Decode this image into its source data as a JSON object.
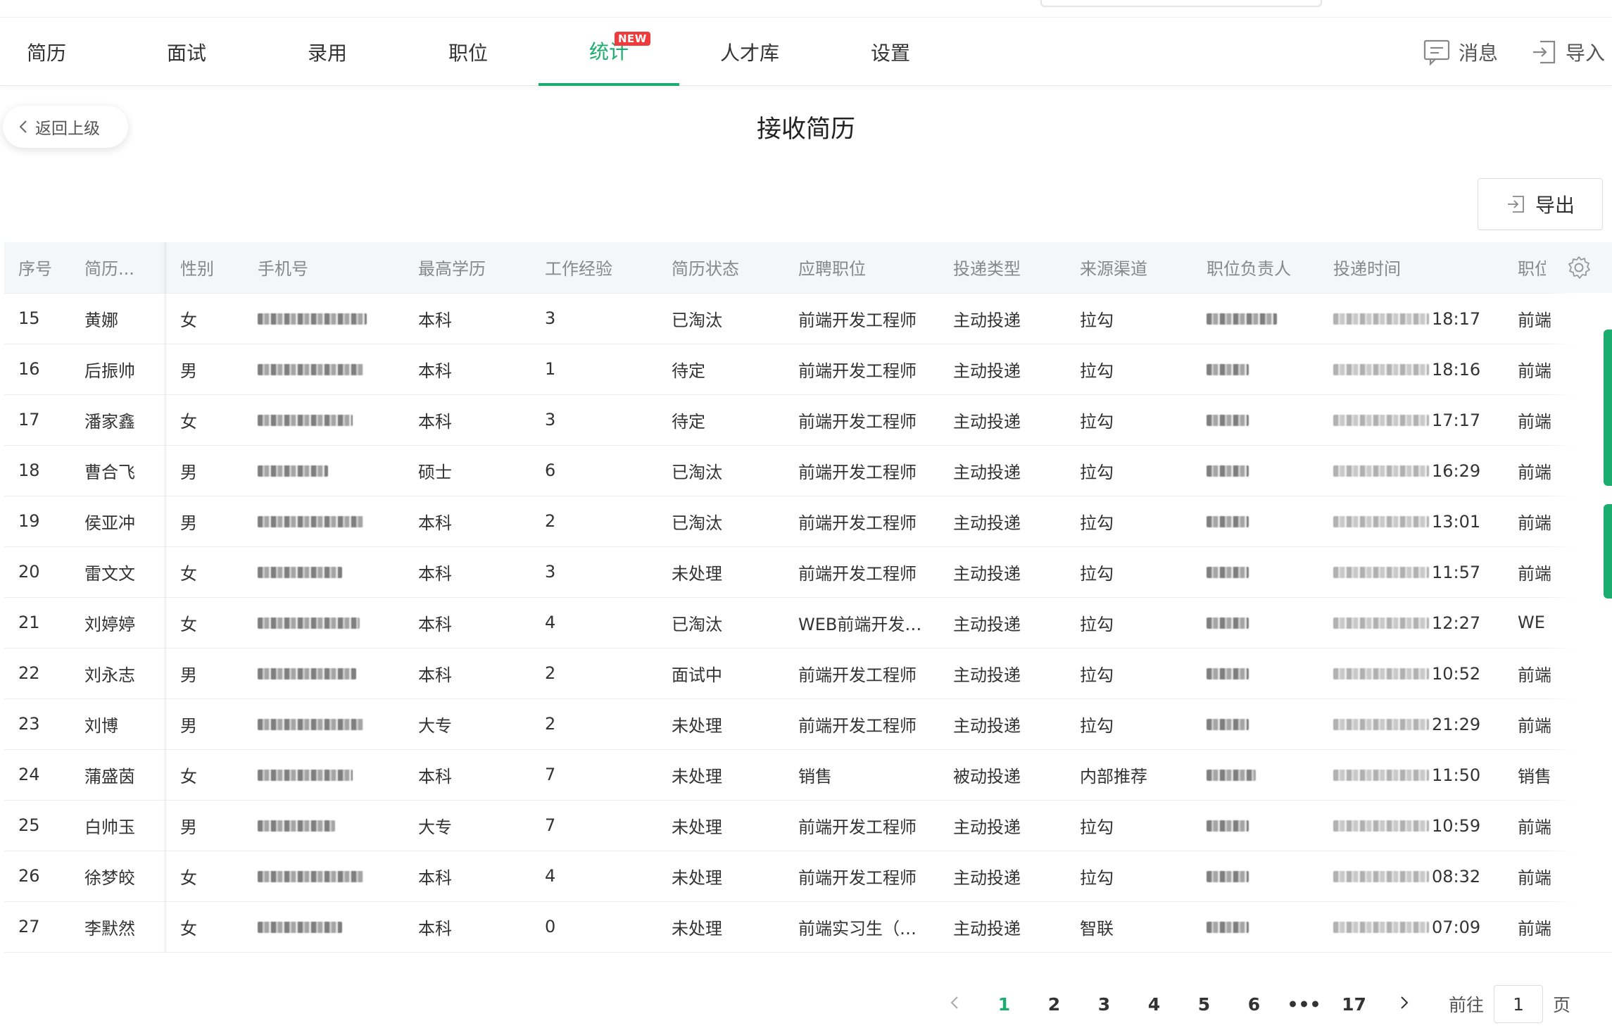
{
  "nav": {
    "tabs": [
      {
        "label": "简历"
      },
      {
        "label": "面试"
      },
      {
        "label": "录用"
      },
      {
        "label": "职位"
      },
      {
        "label": "统计",
        "badge": "NEW"
      },
      {
        "label": "人才库"
      },
      {
        "label": "设置"
      }
    ],
    "messages_label": "消息",
    "import_label": "导入"
  },
  "back_label": "返回上级",
  "page_title": "接收简历",
  "export_label": "导出",
  "table": {
    "columns": [
      "序号",
      "简历...",
      "性别",
      "手机号",
      "最高学历",
      "工作经验",
      "简历状态",
      "应聘职位",
      "投递类型",
      "来源渠道",
      "职位负责人",
      "投递时间",
      "职位"
    ],
    "rows": [
      {
        "no": "15",
        "name": "黄娜",
        "gender": "女",
        "edu": "本科",
        "exp": "3",
        "status": "已淘汰",
        "position": "前端开发工程师",
        "type": "主动投递",
        "source": "拉勾",
        "time": "18:17",
        "pos2": "前端"
      },
      {
        "no": "16",
        "name": "后振帅",
        "gender": "男",
        "edu": "本科",
        "exp": "1",
        "status": "待定",
        "position": "前端开发工程师",
        "type": "主动投递",
        "source": "拉勾",
        "time": "18:16",
        "pos2": "前端"
      },
      {
        "no": "17",
        "name": "潘家鑫",
        "gender": "女",
        "edu": "本科",
        "exp": "3",
        "status": "待定",
        "position": "前端开发工程师",
        "type": "主动投递",
        "source": "拉勾",
        "time": "17:17",
        "pos2": "前端"
      },
      {
        "no": "18",
        "name": "曹合飞",
        "gender": "男",
        "edu": "硕士",
        "exp": "6",
        "status": "已淘汰",
        "position": "前端开发工程师",
        "type": "主动投递",
        "source": "拉勾",
        "time": "16:29",
        "pos2": "前端"
      },
      {
        "no": "19",
        "name": "侯亚冲",
        "gender": "男",
        "edu": "本科",
        "exp": "2",
        "status": "已淘汰",
        "position": "前端开发工程师",
        "type": "主动投递",
        "source": "拉勾",
        "time": "13:01",
        "pos2": "前端"
      },
      {
        "no": "20",
        "name": "雷文文",
        "gender": "女",
        "edu": "本科",
        "exp": "3",
        "status": "未处理",
        "position": "前端开发工程师",
        "type": "主动投递",
        "source": "拉勾",
        "time": "11:57",
        "pos2": "前端"
      },
      {
        "no": "21",
        "name": "刘婷婷",
        "gender": "女",
        "edu": "本科",
        "exp": "4",
        "status": "已淘汰",
        "position": "WEB前端开发…",
        "type": "主动投递",
        "source": "拉勾",
        "time": "12:27",
        "pos2": "WE"
      },
      {
        "no": "22",
        "name": "刘永志",
        "gender": "男",
        "edu": "本科",
        "exp": "2",
        "status": "面试中",
        "position": "前端开发工程师",
        "type": "主动投递",
        "source": "拉勾",
        "time": "10:52",
        "pos2": "前端"
      },
      {
        "no": "23",
        "name": "刘博",
        "gender": "男",
        "edu": "大专",
        "exp": "2",
        "status": "未处理",
        "position": "前端开发工程师",
        "type": "主动投递",
        "source": "拉勾",
        "time": "21:29",
        "pos2": "前端"
      },
      {
        "no": "24",
        "name": "蒲盛茵",
        "gender": "女",
        "edu": "本科",
        "exp": "7",
        "status": "未处理",
        "position": "销售",
        "type": "被动投递",
        "source": "内部推荐",
        "time": "11:50",
        "pos2": "销售"
      },
      {
        "no": "25",
        "name": "白帅玉",
        "gender": "男",
        "edu": "大专",
        "exp": "7",
        "status": "未处理",
        "position": "前端开发工程师",
        "type": "主动投递",
        "source": "拉勾",
        "time": "10:59",
        "pos2": "前端"
      },
      {
        "no": "26",
        "name": "徐梦皎",
        "gender": "女",
        "edu": "本科",
        "exp": "4",
        "status": "未处理",
        "position": "前端开发工程师",
        "type": "主动投递",
        "source": "拉勾",
        "time": "08:32",
        "pos2": "前端"
      },
      {
        "no": "27",
        "name": "李默然",
        "gender": "女",
        "edu": "本科",
        "exp": "0",
        "status": "未处理",
        "position": "前端实习生（…",
        "type": "主动投递",
        "source": "智联",
        "time": "07:09",
        "pos2": "前端"
      }
    ]
  },
  "pagination": {
    "pages": [
      "1",
      "2",
      "3",
      "4",
      "5",
      "6",
      "•••",
      "17"
    ],
    "current": "1",
    "goto_prefix": "前往",
    "goto_value": "1",
    "goto_suffix": "页"
  },
  "colors": {
    "accent": "#1aad6e",
    "badge": "#ef3b3b"
  }
}
